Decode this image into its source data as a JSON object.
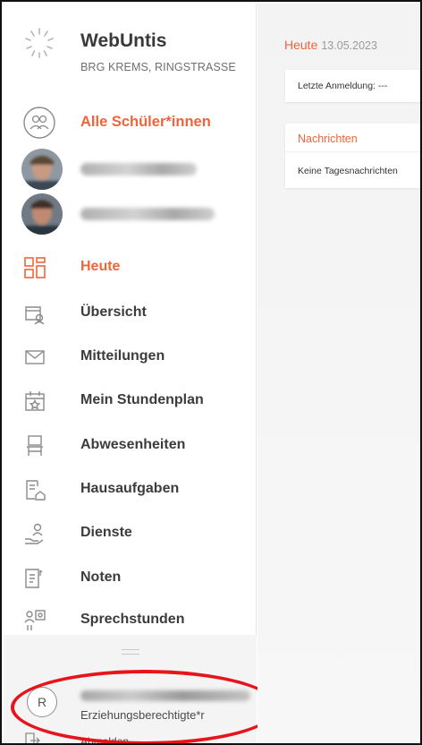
{
  "brand": {
    "app_name": "WebUntis",
    "school": "BRG KREMS, RINGSTRASSE"
  },
  "students": {
    "all_label": "Alle Schüler*innen",
    "items": [
      {
        "name": ""
      },
      {
        "name": ""
      }
    ]
  },
  "nav": {
    "items": [
      {
        "label": "Heute",
        "icon": "dashboard-grid-icon",
        "active": true
      },
      {
        "label": "Übersicht",
        "icon": "overview-icon"
      },
      {
        "label": "Mitteilungen",
        "icon": "envelope-icon"
      },
      {
        "label": "Mein Stundenplan",
        "icon": "calendar-star-icon"
      },
      {
        "label": "Abwesenheiten",
        "icon": "chair-icon"
      },
      {
        "label": "Hausaufgaben",
        "icon": "homework-house-icon"
      },
      {
        "label": "Dienste",
        "icon": "duty-person-icon"
      },
      {
        "label": "Noten",
        "icon": "grades-icon"
      },
      {
        "label": "Sprechstunden",
        "icon": "consultation-icon"
      }
    ]
  },
  "account": {
    "initial": "R",
    "name": "",
    "role": "Erziehungsberechtigte*r",
    "logout_label": "Abmelden"
  },
  "main": {
    "heading": "Heute",
    "date": "13.05.2023",
    "last_login": "Letzte Anmeldung: ---",
    "news_title": "Nachrichten",
    "news_empty": "Keine Tagesnachrichten"
  },
  "colors": {
    "accent": "#f0643b",
    "annotation": "#e8141b"
  }
}
